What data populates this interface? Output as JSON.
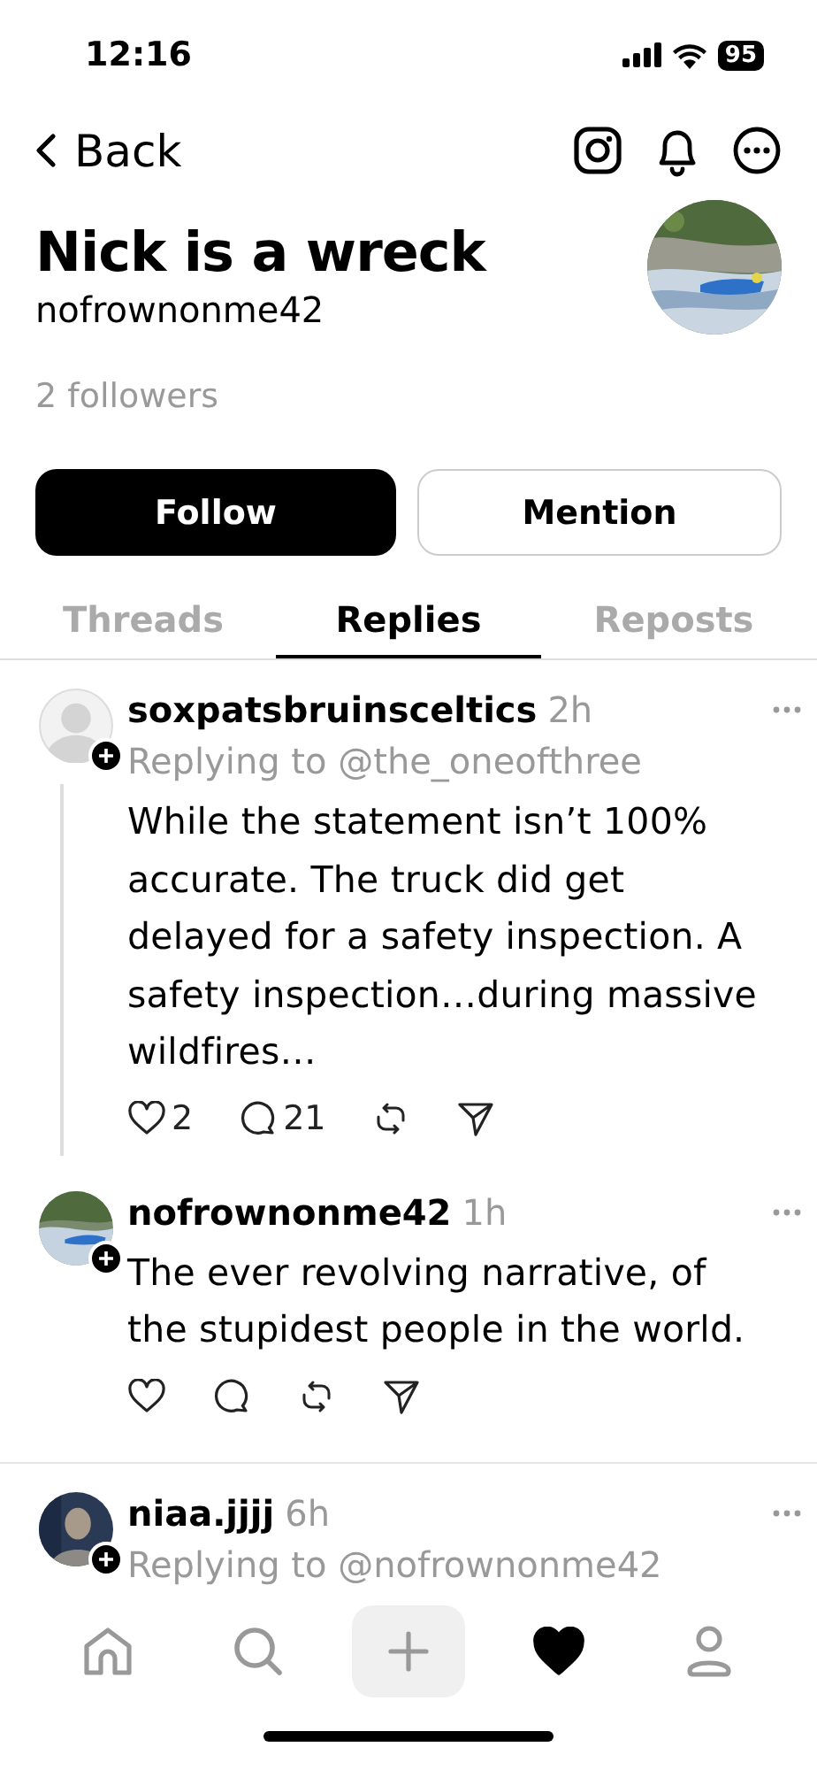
{
  "status_bar": {
    "time": "12:16",
    "battery": "95"
  },
  "header": {
    "back": "Back"
  },
  "profile": {
    "name": "Nick is a wreck",
    "handle": "nofrownonme42",
    "followers": "2 followers"
  },
  "actions": [
    {
      "label": "Follow",
      "kind": "primary"
    },
    {
      "label": "Mention",
      "kind": "secondary"
    }
  ],
  "tabs": [
    {
      "label": "Threads",
      "selected": false
    },
    {
      "label": "Replies",
      "selected": true
    },
    {
      "label": "Reposts",
      "selected": false
    }
  ],
  "posts": [
    {
      "username": "soxpatsbruinsceltics",
      "time": "2h",
      "replying_to": "Replying to @the_oneofthree",
      "text": "While the statement isn’t 100% accurate. The truck did get delayed for a safety inspection. A safety inspection…during massive wildfires…",
      "likes": "2",
      "replies": "21",
      "connected": true,
      "avatar": {
        "kind": "default"
      }
    },
    {
      "username": "nofrownonme42",
      "time": "1h",
      "text": "The ever revolving narrative, of the stupidest people in the world.",
      "connected": false
    },
    {
      "username": "niaa.jjjj",
      "time": "6h",
      "replying_to": "Replying to @nofrownonme42",
      "connected": false,
      "avatar": {
        "kind": "person"
      }
    }
  ],
  "nav": [
    {
      "kind": "home",
      "selected": false
    },
    {
      "kind": "search",
      "selected": false
    },
    {
      "kind": "create",
      "selected": false
    },
    {
      "kind": "activity",
      "selected": true
    },
    {
      "kind": "profile",
      "selected": false
    }
  ]
}
